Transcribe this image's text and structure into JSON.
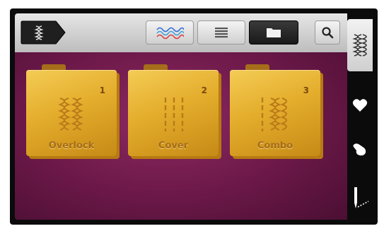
{
  "toolbar": {
    "category_icon": "stitch-category-icon",
    "view_modes": [
      {
        "name": "stitch-preview-view",
        "icon": "wave-stitch-icon",
        "active": false
      },
      {
        "name": "list-view",
        "icon": "list-icon",
        "active": false
      },
      {
        "name": "folder-view",
        "icon": "folder-icon",
        "active": true
      }
    ],
    "search_icon": "search-icon"
  },
  "folders": [
    {
      "number": "1",
      "label": "Overlock",
      "icon": "overlock-stitch-icon"
    },
    {
      "number": "2",
      "label": "Cover",
      "icon": "cover-stitch-icon"
    },
    {
      "number": "3",
      "label": "Combo",
      "icon": "combo-stitch-icon"
    }
  ],
  "sidebar": {
    "items": [
      {
        "icon": "stitch-menu-icon",
        "active": true
      },
      {
        "icon": "heart-icon",
        "active": false
      },
      {
        "icon": "hand-icon",
        "active": false
      },
      {
        "icon": "needle-icon",
        "active": false
      }
    ]
  },
  "colors": {
    "folder_gold": "#e4ad2c",
    "background_magenta": "#8e2a62",
    "toolbar_gray": "#d0d0d0"
  }
}
